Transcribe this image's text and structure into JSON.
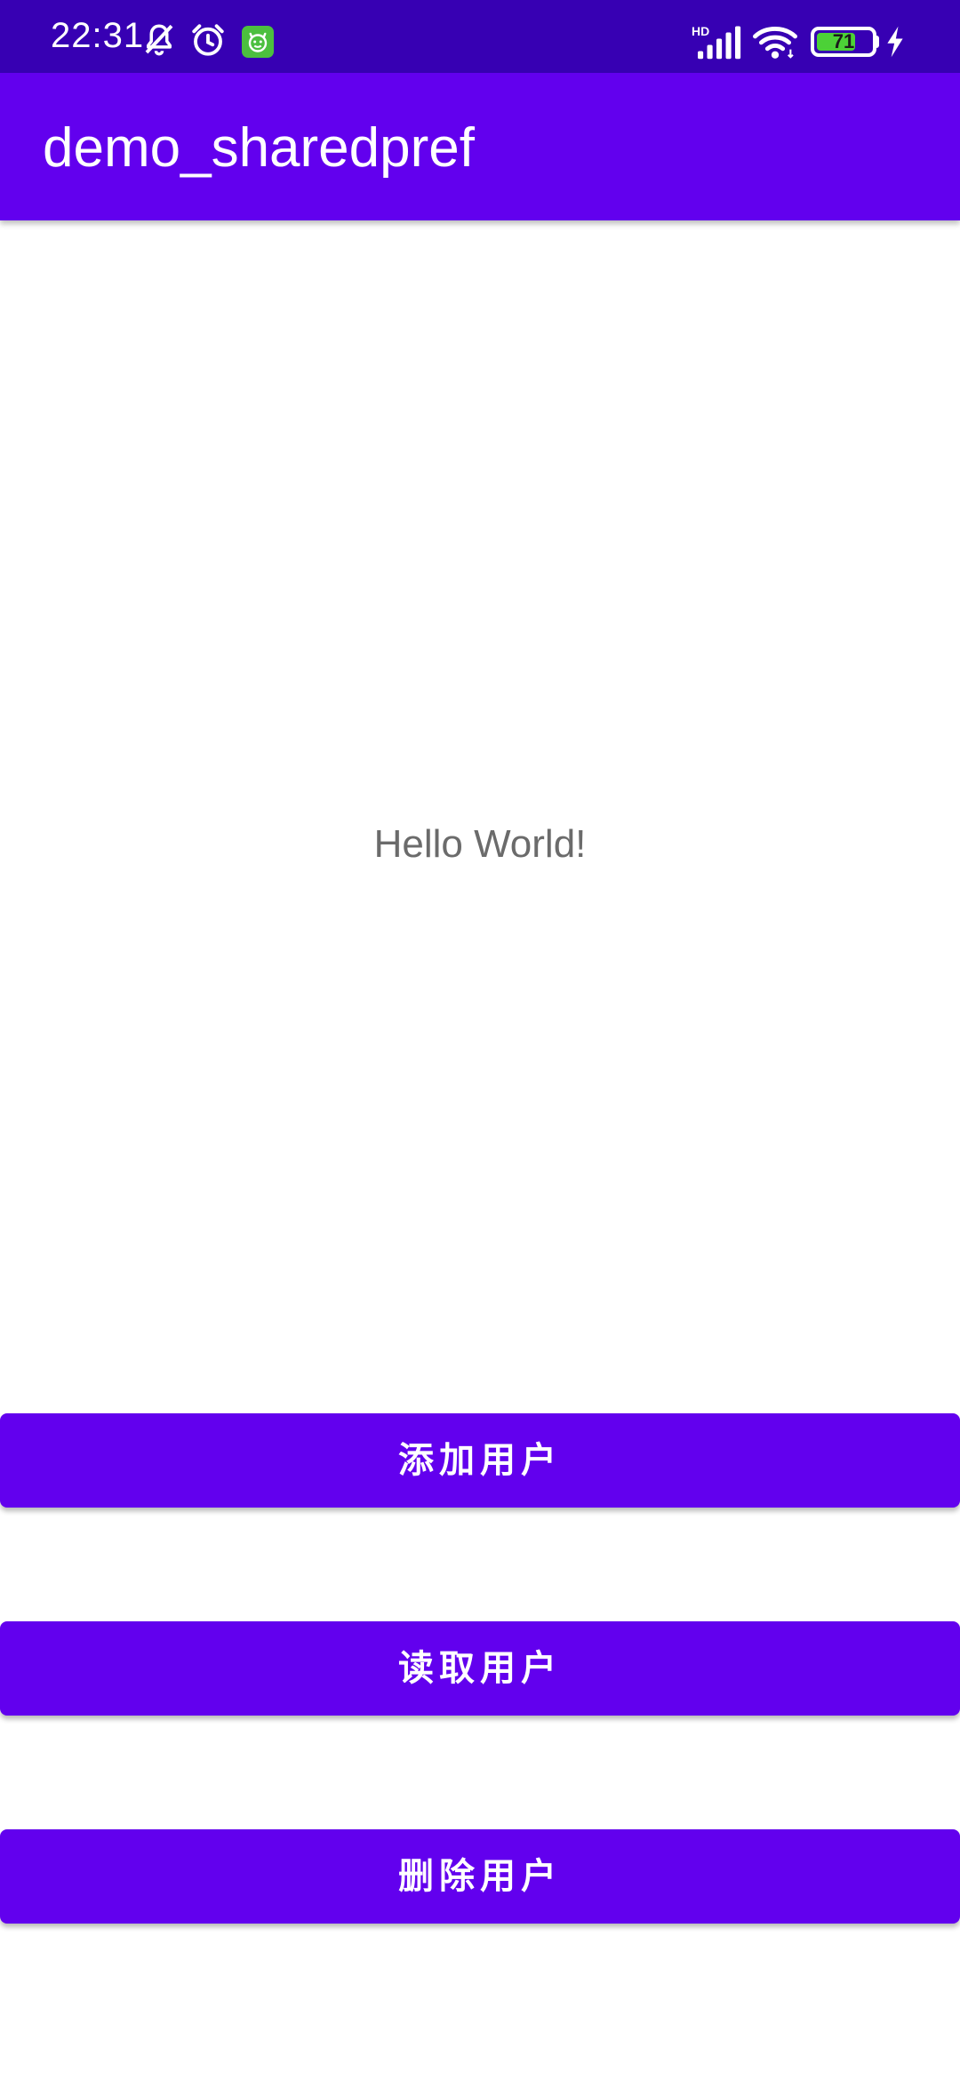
{
  "status_bar": {
    "time": "22:31",
    "icons": [
      "bell-off-icon",
      "alarm-icon",
      "app-notification-icon",
      "hd-signal-icon",
      "wifi-icon",
      "battery-icon",
      "charging-icon"
    ],
    "battery_level": "71",
    "battery_fraction": 0.71,
    "network_label": "HD"
  },
  "app_bar": {
    "title": "demo_sharedpref"
  },
  "main": {
    "hello_text": "Hello World!"
  },
  "buttons": {
    "add_user": "添加用户",
    "read_user": "读取用户",
    "delete_user": "删除用户"
  },
  "colors": {
    "status_bar": "#3700b3",
    "primary": "#6200ee",
    "on_primary": "#ffffff",
    "body_text": "#6b6b6b",
    "battery_fill": "#4cd137"
  }
}
